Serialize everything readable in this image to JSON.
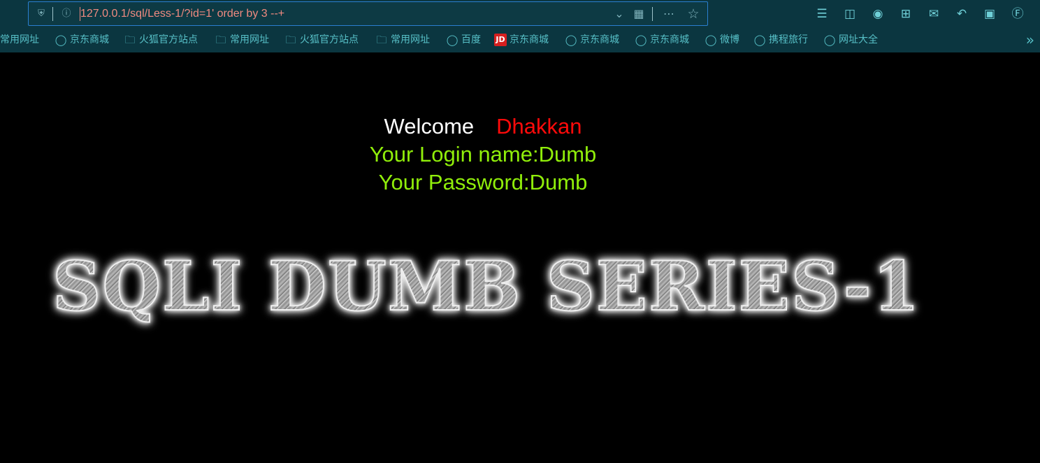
{
  "browser": {
    "url": "127.0.0.1/sql/Less-1/?id=1' order by 3 --+",
    "bookmarks": [
      {
        "label": "常用网址",
        "icon": "none"
      },
      {
        "label": "京东商城",
        "icon": "globe-icon"
      },
      {
        "label": "火狐官方站点",
        "icon": "folder-icon"
      },
      {
        "label": "常用网址",
        "icon": "folder-icon"
      },
      {
        "label": "火狐官方站点",
        "icon": "folder-icon"
      },
      {
        "label": "常用网址",
        "icon": "folder-icon"
      },
      {
        "label": "百度",
        "icon": "globe-icon"
      },
      {
        "label": "京东商城",
        "icon": "jd-icon",
        "icon_text": "JD"
      },
      {
        "label": "京东商城",
        "icon": "globe-icon"
      },
      {
        "label": "京东商城",
        "icon": "globe-icon"
      },
      {
        "label": "微博",
        "icon": "globe-icon"
      },
      {
        "label": "携程旅行",
        "icon": "globe-icon"
      },
      {
        "label": "网址大全",
        "icon": "globe-icon"
      }
    ],
    "toolbar_icons": [
      "library-icon",
      "sidebar-icon",
      "extension-icon",
      "screenshot-icon",
      "chat-icon",
      "undo-icon",
      "translate-icon",
      "tamper-icon"
    ],
    "colors": {
      "toolbar_bg": "#0b3640",
      "url_text": "#f08a80",
      "bookmark_text": "#57c0c7",
      "focus_border": "#2a7fd0"
    }
  },
  "page": {
    "welcome": "Welcome",
    "user": "Dhakkan",
    "login_line": "Your Login name:Dumb",
    "password_line": "Your Password:Dumb",
    "banner": "SQLI DUMB SERIES-1",
    "colors": {
      "background": "#000000",
      "welcome": "#ffffff",
      "user": "#ff0a0a",
      "credentials": "#90ee0a"
    }
  }
}
